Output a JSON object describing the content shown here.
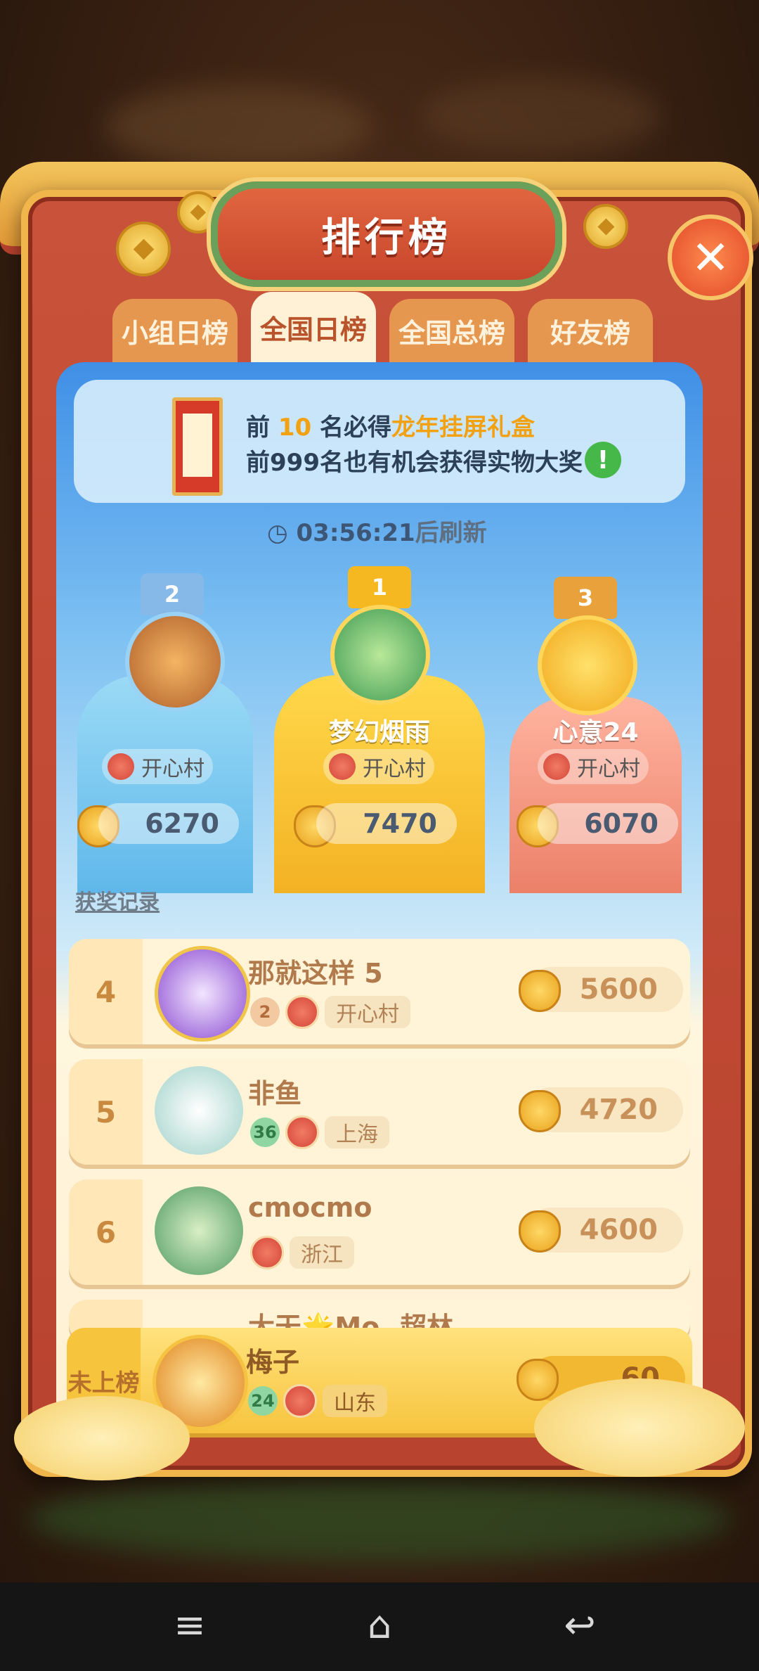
{
  "title": "排行榜",
  "tabs": [
    {
      "label": "小组日榜",
      "active": false
    },
    {
      "label": "全国日榜",
      "active": true
    },
    {
      "label": "全国总榜",
      "active": false
    },
    {
      "label": "好友榜",
      "active": false
    }
  ],
  "notice": {
    "line1_prefix": "前",
    "line1_number": "10",
    "line1_mid": "名必得",
    "line1_prize": "龙年挂屏礼盒",
    "line2": "前999名也有机会获得实物大奖"
  },
  "timer": {
    "value": "03:56:21",
    "suffix": "后刷新"
  },
  "podium": [
    {
      "rank": "2",
      "name": "",
      "club": "开心村",
      "score": "6270",
      "color": "#6cc3ef"
    },
    {
      "rank": "1",
      "name": "梦幻烟雨",
      "club": "开心村",
      "score": "7470",
      "color": "#f6c52e"
    },
    {
      "rank": "3",
      "name": "心意24",
      "club": "开心村",
      "score": "6070",
      "color": "#f19178"
    }
  ],
  "award_link": "获奖记录",
  "rows": [
    {
      "rank": "4",
      "name": "那就这样 5",
      "level": "2",
      "level_color": "orange",
      "region": "开心村",
      "score": "5600"
    },
    {
      "rank": "5",
      "name": "非鱼",
      "level": "36",
      "level_color": "green",
      "region": "上海",
      "score": "4720"
    },
    {
      "rank": "6",
      "name": "cmocmo",
      "level": "",
      "level_color": "",
      "region": "浙江",
      "score": "4600"
    }
  ],
  "peek_row_name": "大天🌟Mo..超林",
  "self_row": {
    "rank": "未上榜",
    "name": "梅子",
    "level": "24",
    "region": "山东",
    "score": "60"
  },
  "nav": {
    "menu": "≡",
    "home": "⌂",
    "back": "↩"
  }
}
